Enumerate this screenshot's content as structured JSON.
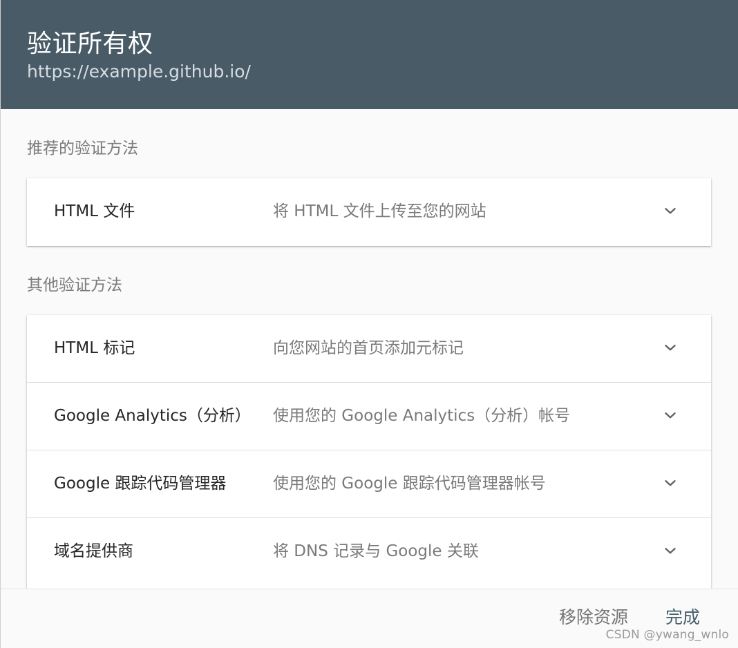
{
  "dialog": {
    "title": "验证所有权",
    "subtitle": "https://example.github.io/"
  },
  "sections": {
    "recommended_label": "推荐的验证方法",
    "other_label": "其他验证方法"
  },
  "methods": {
    "recommended": [
      {
        "name": "HTML 文件",
        "description": "将 HTML 文件上传至您的网站",
        "icon": "chevron-down-icon"
      }
    ],
    "other": [
      {
        "name": "HTML 标记",
        "description": "向您网站的首页添加元标记",
        "icon": "chevron-down-icon"
      },
      {
        "name": "Google Analytics（分析）",
        "description": "使用您的 Google Analytics（分析）帐号",
        "icon": "chevron-down-icon"
      },
      {
        "name": "Google 跟踪代码管理器",
        "description": "使用您的 Google 跟踪代码管理器帐号",
        "icon": "chevron-down-icon"
      },
      {
        "name": "域名提供商",
        "description": "将 DNS 记录与 Google 关联",
        "icon": "chevron-down-icon"
      }
    ]
  },
  "footer": {
    "remove_label": "移除资源",
    "done_label": "完成"
  },
  "watermark": "CSDN @ywang_wnlo",
  "colors": {
    "header_background": "#495b67",
    "header_text": "#ffffff",
    "header_subtitle": "#d7dde1",
    "page_background": "#fafafa",
    "card_background": "#ffffff",
    "section_label": "#7b7b7b",
    "primary_text": "#262626",
    "secondary_text": "#7a7a7a",
    "chevron": "#5f6368",
    "done_button": "#47606d",
    "remove_button": "#757575"
  }
}
